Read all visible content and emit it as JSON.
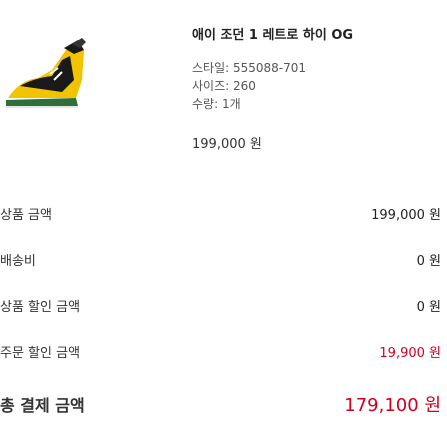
{
  "product": {
    "name": "애이 조던 1 레트로 하이 OG",
    "style_code": "스타일: 555088-701",
    "size": "사이즈: 260",
    "quantity": "수량: 1개",
    "unit_price": "199,000 원"
  },
  "summary": {
    "rows": [
      {
        "label": "상품 금액",
        "value": "199,000 원"
      },
      {
        "label": "배송비",
        "value": "0 원"
      },
      {
        "label": "상품 할인 금액",
        "value": "0 원"
      },
      {
        "label": "주문 할인 금액",
        "value": "19,900 원"
      },
      {
        "label": "총 결제 금액",
        "value": "179,100 원"
      }
    ]
  },
  "colors": {
    "accent": "#d1001f",
    "sneaker_yellow": "#f2c300",
    "sneaker_black": "#1a1a1a",
    "sneaker_green": "#2e6f3a"
  }
}
